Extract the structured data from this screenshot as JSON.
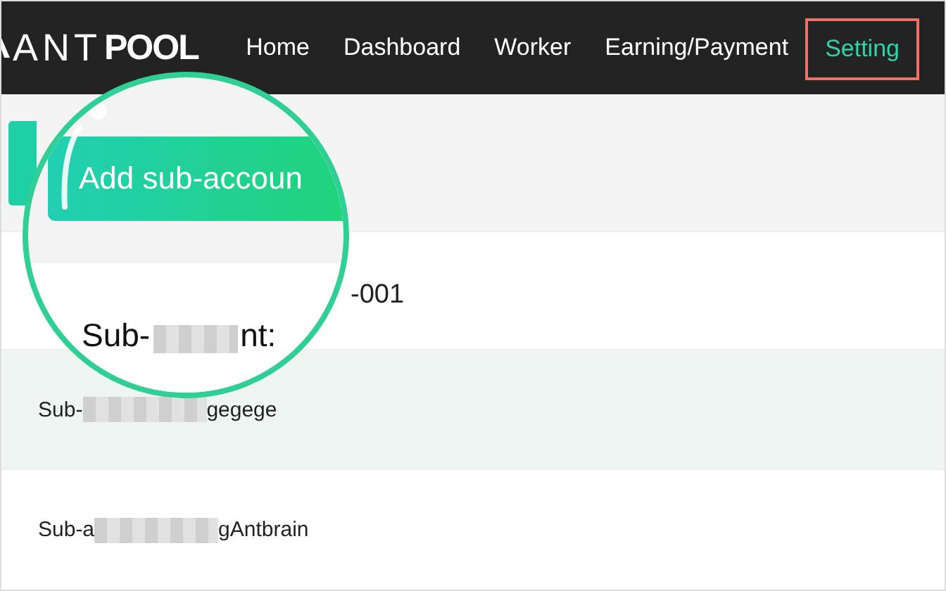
{
  "logo": {
    "light": "ANT",
    "bold": "POOL"
  },
  "nav": [
    {
      "label": "Home",
      "selected": false,
      "annotated": false
    },
    {
      "label": "Dashboard",
      "selected": false,
      "annotated": false
    },
    {
      "label": "Worker",
      "selected": false,
      "annotated": false
    },
    {
      "label": "Earning/Payment",
      "selected": false,
      "annotated": false
    },
    {
      "label": "Setting",
      "selected": true,
      "annotated": true
    }
  ],
  "magnifier": {
    "button": "Add sub-accoun",
    "row": [
      {
        "kind": "text",
        "text": "Sub-"
      },
      {
        "kind": "blur"
      },
      {
        "kind": "text",
        "text": "nt:"
      }
    ]
  },
  "rows": [
    {
      "shaded": false,
      "large": true,
      "segments": [
        {
          "kind": "text",
          "text": "-001"
        }
      ]
    },
    {
      "shaded": true,
      "large": false,
      "segments": [
        {
          "kind": "text",
          "text": "Sub-"
        },
        {
          "kind": "blur"
        },
        {
          "kind": "text",
          "text": "gegege"
        }
      ]
    },
    {
      "shaded": false,
      "large": false,
      "segments": [
        {
          "kind": "text",
          "text": "Sub-a"
        },
        {
          "kind": "blur"
        },
        {
          "kind": "text",
          "text": "gAntbrain"
        }
      ]
    }
  ]
}
